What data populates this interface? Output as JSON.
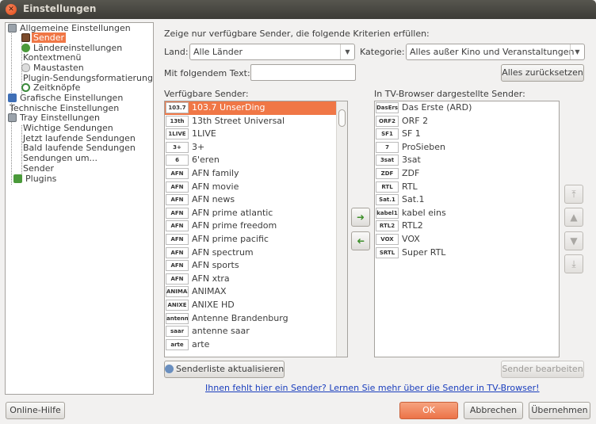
{
  "window": {
    "title": "Einstellungen"
  },
  "tree": [
    {
      "label": "Allgemeine Einstellungen",
      "icon": "settings-page-icon",
      "color": "#9aa2aa"
    },
    {
      "label": "Sender",
      "icon": "tv-icon",
      "color": "#7b4a2b",
      "selected": true
    },
    {
      "label": "Ländereinstellungen",
      "icon": "globe-icon",
      "color": "#4a9a3a"
    },
    {
      "label": "Kontextmenü",
      "icon": "",
      "color": ""
    },
    {
      "label": "Maustasten",
      "icon": "mouse-icon",
      "color": "#bfbfbf"
    },
    {
      "label": "Plugin-Sendungsformatierung",
      "icon": "",
      "color": ""
    },
    {
      "label": "Zeitknöpfe",
      "icon": "clock-icon",
      "color": "#3a8a3a"
    },
    {
      "label": "Grafische Einstellungen",
      "icon": "paint-icon",
      "color": "#3f6fb6"
    },
    {
      "label": "Technische Einstellungen",
      "icon": "",
      "color": ""
    },
    {
      "label": "Tray Einstellungen",
      "icon": "tray-icon",
      "color": "#9aa2aa"
    },
    {
      "label": "Wichtige Sendungen",
      "icon": "",
      "color": ""
    },
    {
      "label": "Jetzt laufende Sendungen",
      "icon": "",
      "color": ""
    },
    {
      "label": "Bald laufende Sendungen",
      "icon": "",
      "color": ""
    },
    {
      "label": "Sendungen um...",
      "icon": "",
      "color": ""
    },
    {
      "label": "Sender",
      "icon": "",
      "color": ""
    },
    {
      "label": "Plugins",
      "icon": "plugin-icon",
      "color": "#4a9a3a"
    }
  ],
  "filter": {
    "heading": "Zeige nur verfügbare Sender, die folgende Kriterien erfüllen:",
    "land_label": "Land:",
    "land_value": "Alle Länder",
    "kategorie_label": "Kategorie:",
    "kategorie_value": "Alles außer Kino und Veranstaltungen",
    "text_label": "Mit folgendem Text:",
    "text_value": "",
    "reset_button": "Alles zurücksetzen"
  },
  "available": {
    "heading": "Verfügbare Sender:",
    "items": [
      {
        "name": "103.7 UnserDing",
        "logo": "103.7",
        "selected": true
      },
      {
        "name": "13th Street Universal",
        "logo": "13th"
      },
      {
        "name": "1LIVE",
        "logo": "1LIVE"
      },
      {
        "name": "3+",
        "logo": "3+"
      },
      {
        "name": "6'eren",
        "logo": "6"
      },
      {
        "name": "AFN family",
        "logo": "AFN"
      },
      {
        "name": "AFN movie",
        "logo": "AFN"
      },
      {
        "name": "AFN news",
        "logo": "AFN"
      },
      {
        "name": "AFN prime atlantic",
        "logo": "AFN"
      },
      {
        "name": "AFN prime freedom",
        "logo": "AFN"
      },
      {
        "name": "AFN prime pacific",
        "logo": "AFN"
      },
      {
        "name": "AFN spectrum",
        "logo": "AFN"
      },
      {
        "name": "AFN sports",
        "logo": "AFN"
      },
      {
        "name": "AFN xtra",
        "logo": "AFN"
      },
      {
        "name": "ANIMAX",
        "logo": "ANIMAX"
      },
      {
        "name": "ANIXE HD",
        "logo": "ANIXE"
      },
      {
        "name": "Antenne Brandenburg",
        "logo": "antenne"
      },
      {
        "name": "antenne saar",
        "logo": "saar"
      },
      {
        "name": "arte",
        "logo": "arte"
      }
    ],
    "refresh_button": "Senderliste aktualisieren"
  },
  "displayed": {
    "heading": "In TV-Browser dargestellte Sender:",
    "items": [
      {
        "name": "Das Erste (ARD)",
        "logo": "DasErste"
      },
      {
        "name": "ORF 2",
        "logo": "ORF2"
      },
      {
        "name": "SF 1",
        "logo": "SF1"
      },
      {
        "name": "ProSieben",
        "logo": "7"
      },
      {
        "name": "3sat",
        "logo": "3sat"
      },
      {
        "name": "ZDF",
        "logo": "ZDF"
      },
      {
        "name": "RTL",
        "logo": "RTL"
      },
      {
        "name": "Sat.1",
        "logo": "Sat.1"
      },
      {
        "name": "kabel eins",
        "logo": "kabel1"
      },
      {
        "name": "RTL2",
        "logo": "RTL2"
      },
      {
        "name": "VOX",
        "logo": "VOX"
      },
      {
        "name": "Super RTL",
        "logo": "SRTL"
      }
    ],
    "edit_button": "Sender bearbeiten"
  },
  "link_text": "Ihnen fehlt hier ein Sender? Lernen Sie mehr über die Sender in TV-Browser!",
  "footer": {
    "help": "Online-Hilfe",
    "ok": "OK",
    "cancel": "Abbrechen",
    "apply": "Übernehmen"
  },
  "colors": {
    "accent": "#f07746",
    "link": "#1a3ebd"
  }
}
